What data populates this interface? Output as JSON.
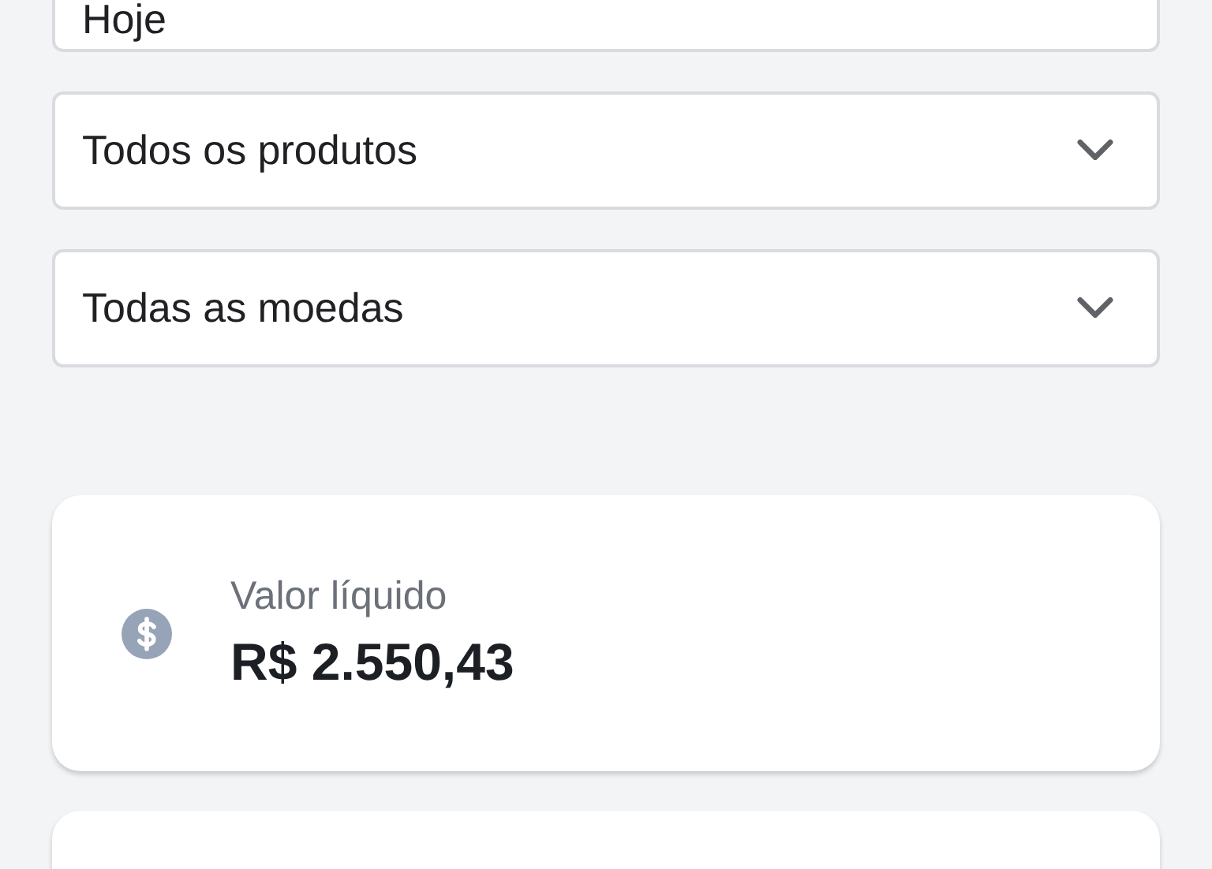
{
  "filters": [
    {
      "value": "Hoje",
      "cut": true
    },
    {
      "value": "Todos os produtos",
      "cut": false
    },
    {
      "value": "Todas as moedas",
      "cut": false
    }
  ],
  "summary_cards": [
    {
      "label": "Valor líquido",
      "value": "R$ 2.550,43"
    }
  ]
}
